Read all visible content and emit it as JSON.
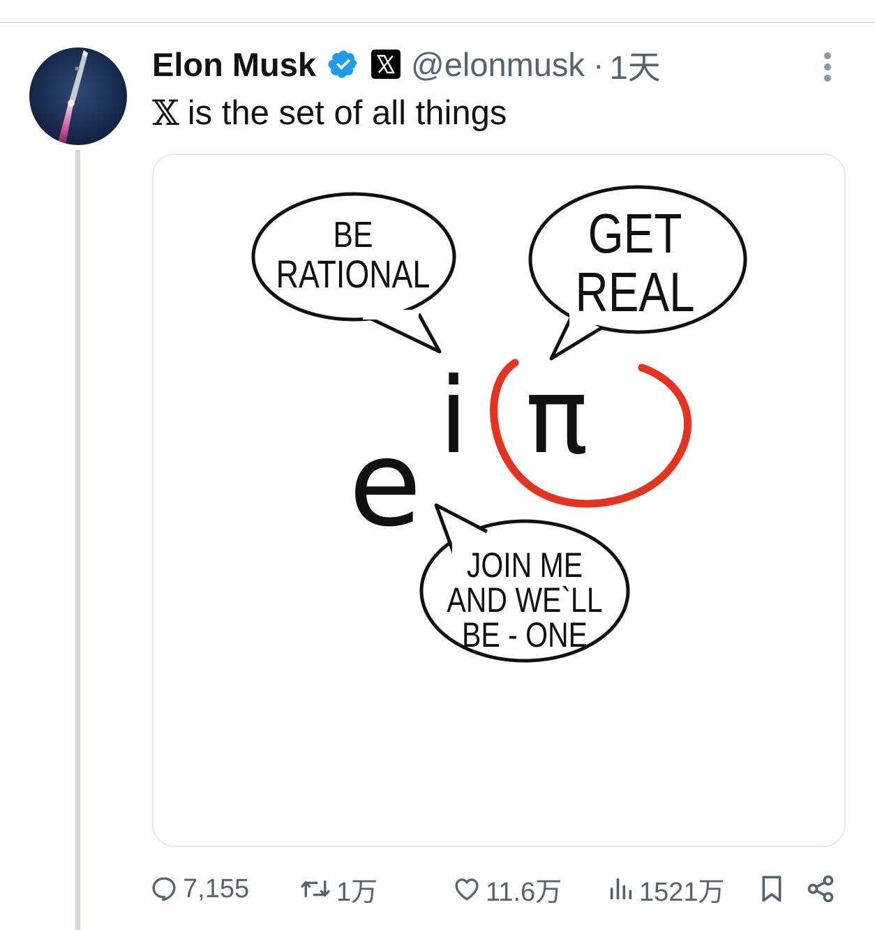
{
  "author": {
    "name": "Elon Musk",
    "handle": "@elonmusk",
    "separator": "·",
    "time": "1天"
  },
  "tweet": {
    "logo_glyph": "𝕏",
    "text": "is the set of all things"
  },
  "media": {
    "bubbles": {
      "top_left": [
        "BE",
        "RATIONAL"
      ],
      "top_right": [
        "GET",
        "REAL"
      ],
      "bottom": [
        "JOIN ME",
        "AND WE`LL",
        "BE - ONE"
      ]
    },
    "symbols": {
      "base": "e",
      "i": "i",
      "pi": "π"
    },
    "circle_color": "#e8321e"
  },
  "actions": {
    "replies": "7,155",
    "retweets": "1万",
    "likes": "11.6万",
    "views": "1521万"
  },
  "colors": {
    "text": "#0f1419",
    "muted": "#536471",
    "verified": "#1d9bf0"
  }
}
